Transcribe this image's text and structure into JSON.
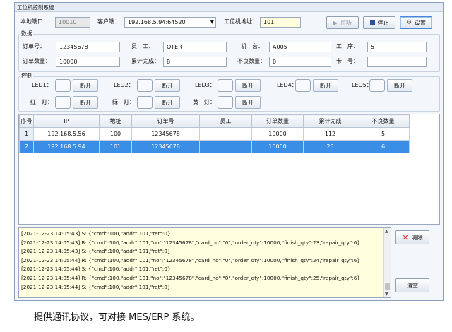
{
  "window": {
    "title": "工位机控制系统"
  },
  "toolbar": {
    "local_port_label": "本地端口：",
    "local_port_value": "10010",
    "client_label": "客户端：",
    "client_value": "192.168.5.94:64520",
    "station_addr_label": "工位机地址：",
    "station_addr_value": "101",
    "listen_label": "监听",
    "stop_label": "停止",
    "settings_label": "设置"
  },
  "data_group": {
    "title": "数据",
    "order_no_label": "订单号：",
    "order_no_value": "12345678",
    "staff_label": "员　工：",
    "staff_value": "QTER",
    "machine_label": "机　台：",
    "machine_value": "A005",
    "process_label": "工　序：",
    "process_value": "5",
    "order_qty_label": "订单数量：",
    "order_qty_value": "10000",
    "finish_label": "累计完成：",
    "finish_value": "8",
    "defect_label": "不良数量：",
    "defect_value": "0",
    "card_label": "卡　号：",
    "card_value": ""
  },
  "control_group": {
    "title": "控制",
    "leds": [
      {
        "label": "LED1：",
        "button": "断开"
      },
      {
        "label": "LED2：",
        "button": "断开"
      },
      {
        "label": "LED3：",
        "button": "断开"
      },
      {
        "label": "LED4：",
        "button": "断开"
      },
      {
        "label": "LED5：",
        "button": "断开"
      }
    ],
    "lamps": [
      {
        "label": "红　灯：",
        "button": "断开"
      },
      {
        "label": "绿　灯：",
        "button": "断开"
      },
      {
        "label": "黄　灯：",
        "button": "断开"
      }
    ]
  },
  "table": {
    "columns": [
      "序号",
      "IP",
      "地址",
      "订单号",
      "员工",
      "订单数量",
      "累计完成",
      "不良数量"
    ],
    "rows": [
      [
        "1",
        "192.168.5.56",
        "100",
        "12345678",
        "",
        "10000",
        "112",
        "5"
      ],
      [
        "2",
        "192.168.5.94",
        "101",
        "12345678",
        "",
        "10000",
        "25",
        "6"
      ]
    ],
    "selected_row": 1
  },
  "log": {
    "lines": [
      "[2021-12-23 14:05:43] S: {\"cmd\":100,\"addr\":101,\"ret\":0}",
      "[2021-12-23 14:05:43] R: {\"cmd\":100,\"addr\":101,\"no\":\"12345678\",\"card_no\":\"0\",\"order_qty\":10000,\"finish_qty\":23,\"repair_qty\":6}",
      "[2021-12-23 14:05:43] S: {\"cmd\":100,\"addr\":101,\"ret\":0}",
      "[2021-12-23 14:05:44] R: {\"cmd\":100,\"addr\":101,\"no\":\"12345678\",\"card_no\":\"0\",\"order_qty\":10000,\"finish_qty\":24,\"repair_qty\":6}",
      "[2021-12-23 14:05:44] S: {\"cmd\":100,\"addr\":101,\"ret\":0}",
      "[2021-12-23 14:05:44] R: {\"cmd\":100,\"addr\":101,\"no\":\"12345678\",\"card_no\":\"0\",\"order_qty\":10000,\"finish_qty\":25,\"repair_qty\":6}",
      "[2021-12-23 14:05:44] S: {\"cmd\":100,\"addr\":101,\"ret\":0}"
    ],
    "clear_label": "清除",
    "empty_label": "清空"
  },
  "caption": "提供通讯协议，可对接 MES/ERP 系统。",
  "colors": {
    "selection": "#3a8ee6",
    "log_background": "#ffffdf",
    "clear_icon": "#d9302a",
    "stop_icon": "#2d4ea0"
  }
}
